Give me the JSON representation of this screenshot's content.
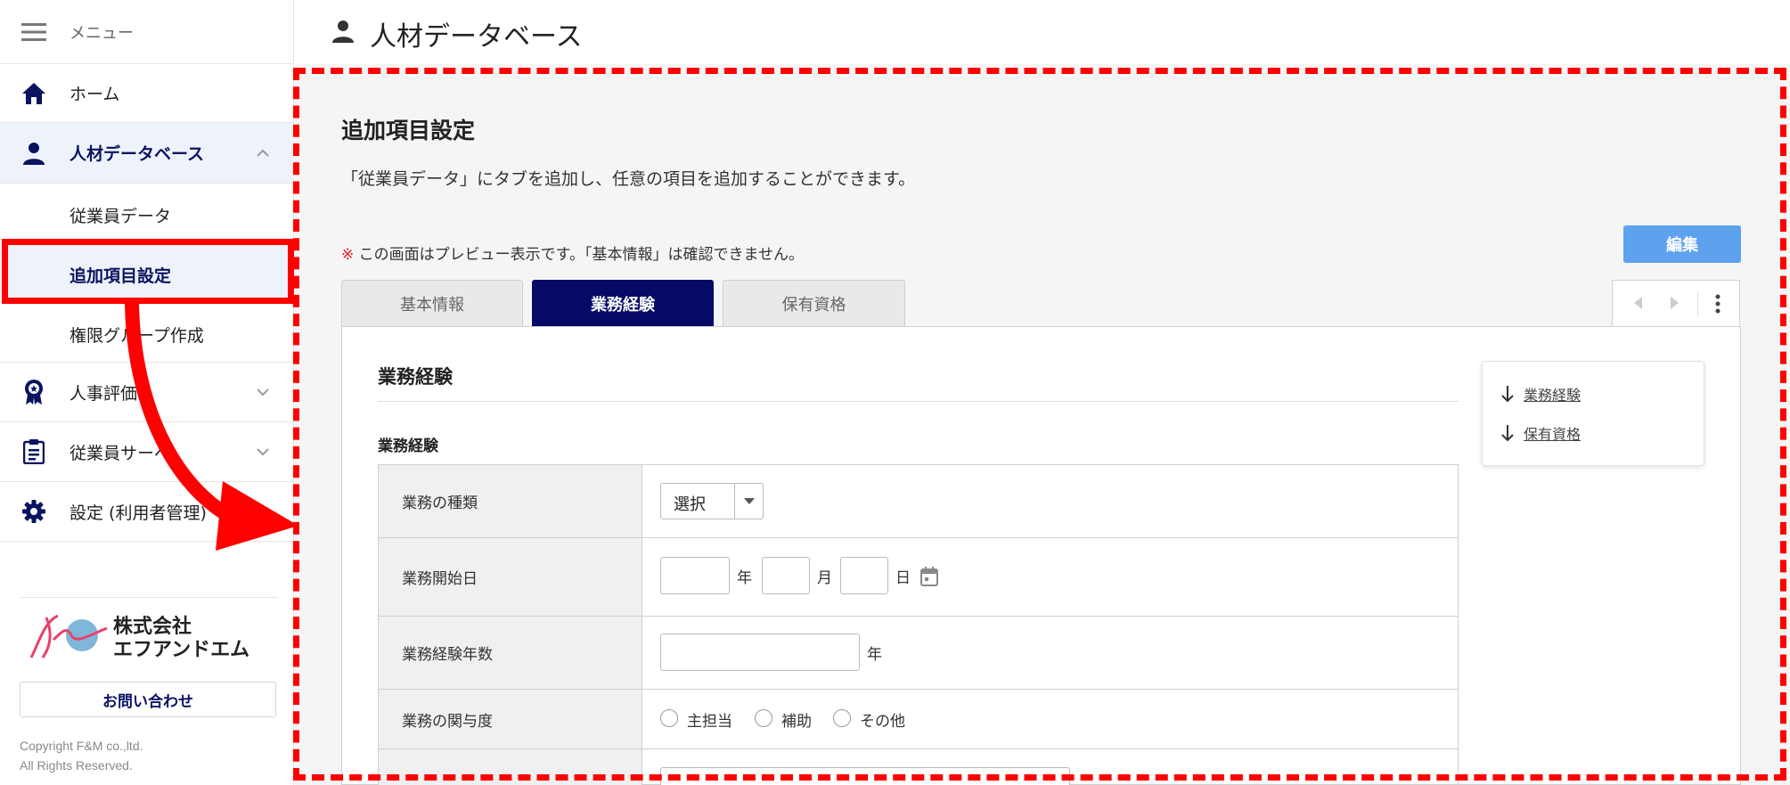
{
  "sidebar": {
    "menu_label": "メニュー",
    "home_label": "ホーム",
    "database_label": "人材データベース",
    "sub_items": [
      "従業員データ",
      "追加項目設定",
      "権限グループ作成"
    ],
    "evaluation_label": "人事評価",
    "survey_label": "従業員サーベ",
    "settings_label": "設定 (利用者管理)",
    "logo_line1": "株式会社",
    "logo_line2": "エフアンドエム",
    "contact_label": "お問い合わせ",
    "copyright_line1": "Copyright F&M co.,ltd.",
    "copyright_line2": "All Rights Reserved."
  },
  "header": {
    "title": "人材データベース"
  },
  "main": {
    "heading": "追加項目設定",
    "description": "「従業員データ」にタブを追加し、任意の項目を追加することができます。",
    "note_mark": "※",
    "note_text": " この画面はプレビュー表示です。「基本情報」は確認できません。",
    "edit_label": "編集",
    "tabs": [
      "基本情報",
      "業務経験",
      "保有資格"
    ],
    "section_title": "業務経験",
    "subsection_title": "業務経験",
    "rows": [
      {
        "label": "業務の種類"
      },
      {
        "label": "業務開始日"
      },
      {
        "label": "業務経験年数"
      },
      {
        "label": "業務の関与度"
      }
    ],
    "select_value": "選択",
    "unit_year": "年",
    "unit_month": "月",
    "unit_day": "日",
    "radio_options": [
      "主担当",
      "補助",
      "その他"
    ],
    "anchors": [
      "業務経験",
      "保有資格"
    ]
  },
  "colors": {
    "accent_navy": "#050a66",
    "edit_blue": "#5ea2ee",
    "highlight_red": "#ff0000"
  }
}
